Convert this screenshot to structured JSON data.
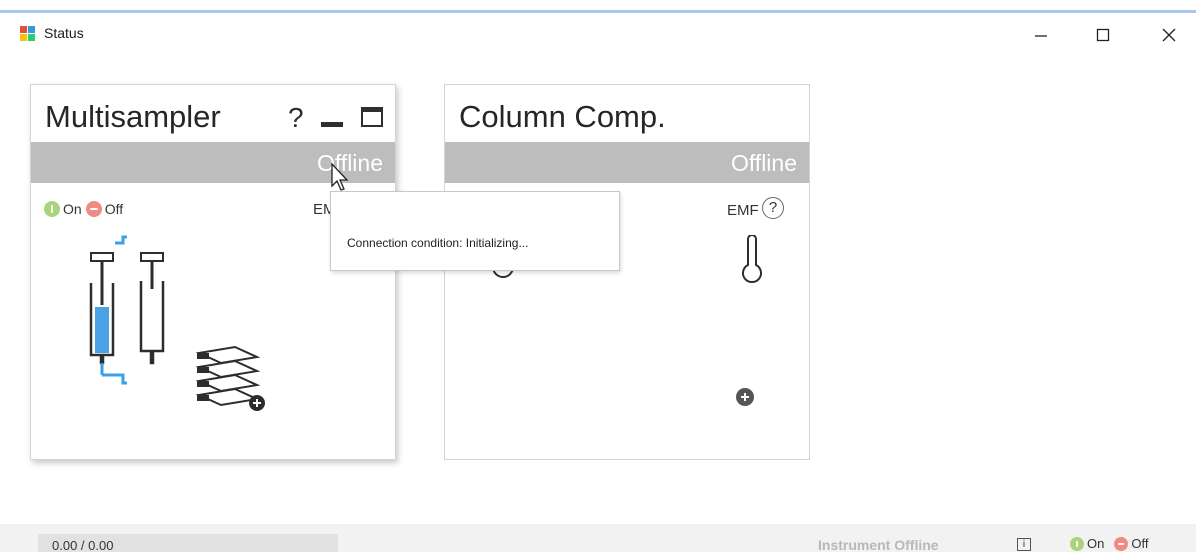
{
  "window": {
    "title": "Status",
    "minimize_glyph": "—",
    "maximize_glyph": "☐",
    "close_glyph": "✕"
  },
  "modules": [
    {
      "title": "Multisampler",
      "status": "Offline",
      "help_glyph": "?",
      "on_label": "On",
      "off_label": "Off",
      "emf_label": "EMF"
    },
    {
      "title": "Column Comp.",
      "status": "Offline",
      "emf_label": "EMF",
      "help_glyph": "?"
    }
  ],
  "tooltip": {
    "text": "Connection condition: Initializing..."
  },
  "statusbar": {
    "progress": "0.00 / 0.00",
    "instrument_status": "Instrument Offline",
    "info_glyph": "i",
    "on_label": "On",
    "off_label": "Off"
  },
  "colors": {
    "status_offline_bar": "#bdbdbd",
    "on_indicator": "#a8d57c",
    "off_indicator": "#ef8b83",
    "sample_fill": "#4aa3e6",
    "accent_line": "#a9c6ec"
  },
  "icons": [
    "app-icon",
    "syringe-icon",
    "sample-trays-icon",
    "thermometer-icon",
    "add-icon",
    "info-icon",
    "cursor-icon"
  ]
}
